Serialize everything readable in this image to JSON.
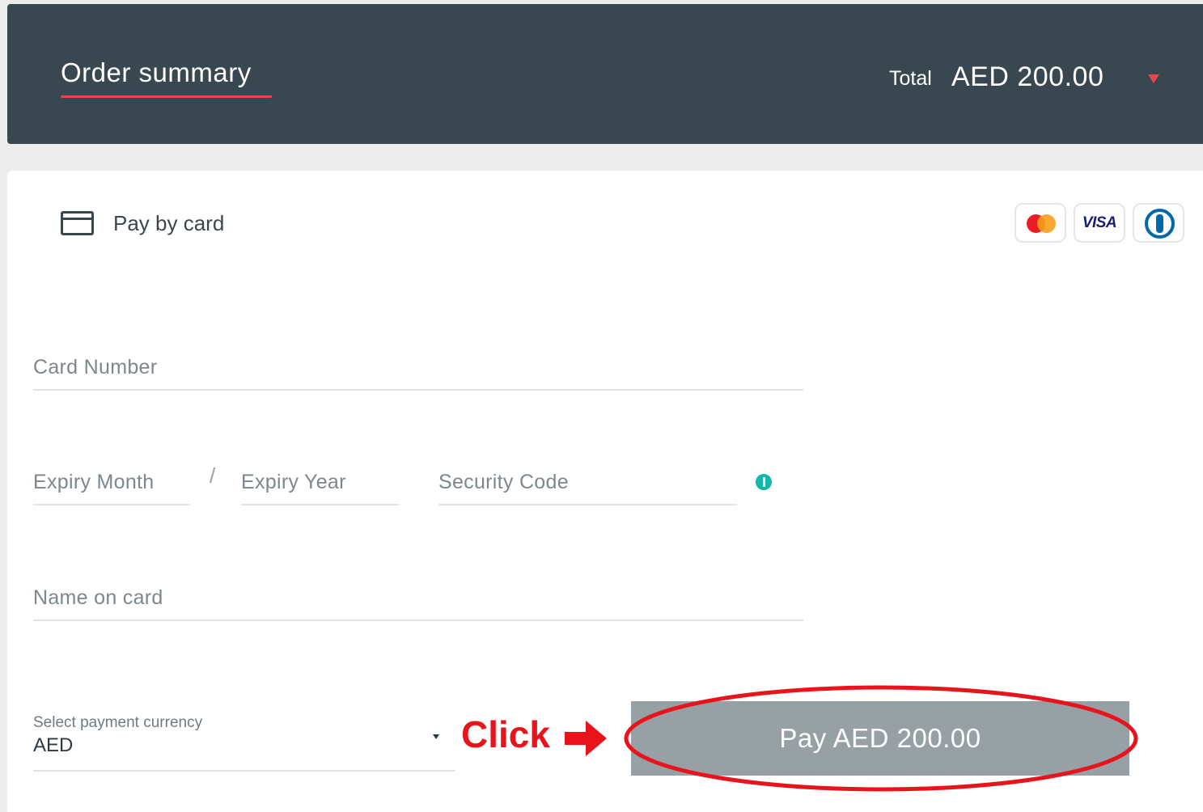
{
  "header": {
    "title": "Order summary",
    "total_label": "Total",
    "total_amount": "AED 200.00"
  },
  "payment": {
    "method_label": "Pay by card",
    "card_brands": [
      "mastercard-icon",
      "visa-icon",
      "diners-club-icon"
    ],
    "visa_text": "VISA"
  },
  "form": {
    "card_number": {
      "placeholder": "Card Number",
      "value": ""
    },
    "expiry_month": {
      "placeholder": "Expiry Month",
      "value": ""
    },
    "expiry_separator": "/",
    "expiry_year": {
      "placeholder": "Expiry Year",
      "value": ""
    },
    "security_code": {
      "placeholder": "Security Code",
      "value": ""
    },
    "name_on_card": {
      "placeholder": "Name on card",
      "value": ""
    },
    "currency": {
      "label": "Select payment currency",
      "selected": "AED"
    }
  },
  "annotation": {
    "click_text": "Click"
  },
  "pay_button": {
    "label": "Pay AED 200.00"
  },
  "colors": {
    "header_bg": "#384750",
    "accent_red": "#e8484d",
    "pay_button_bg": "#96a0a5",
    "info_icon": "#14b8a6",
    "annotation_red": "#e8141b"
  }
}
